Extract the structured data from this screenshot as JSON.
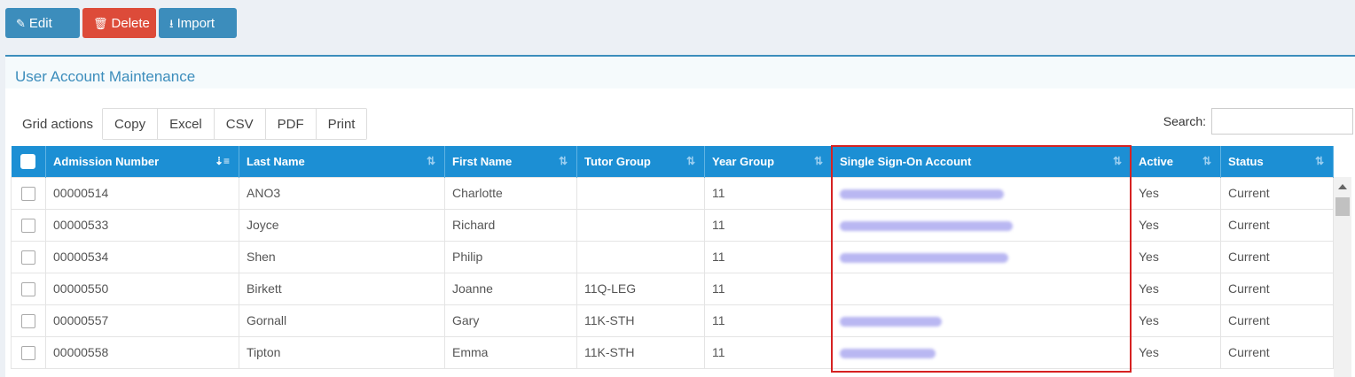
{
  "toolbar": {
    "edit": "Edit",
    "delete": "Delete",
    "import": "Import"
  },
  "panel": {
    "title": "User Account Maintenance"
  },
  "grid_actions": {
    "label": "Grid actions",
    "buttons": [
      "Copy",
      "Excel",
      "CSV",
      "PDF",
      "Print"
    ]
  },
  "search": {
    "label": "Search:",
    "value": ""
  },
  "table": {
    "columns": [
      "",
      "Admission Number",
      "Last Name",
      "First Name",
      "Tutor Group",
      "Year Group",
      "Single Sign-On Account",
      "Active",
      "Status"
    ],
    "rows": [
      {
        "admission": "00000514",
        "last": "ANO3",
        "first": "Charlotte",
        "tutor": "",
        "year": "11",
        "sso_redacted": true,
        "active": "Yes",
        "status": "Current"
      },
      {
        "admission": "00000533",
        "last": "Joyce",
        "first": "Richard",
        "tutor": "",
        "year": "11",
        "sso_redacted": true,
        "active": "Yes",
        "status": "Current"
      },
      {
        "admission": "00000534",
        "last": "Shen",
        "first": "Philip",
        "tutor": "",
        "year": "11",
        "sso_redacted": true,
        "active": "Yes",
        "status": "Current"
      },
      {
        "admission": "00000550",
        "last": "Birkett",
        "first": "Joanne",
        "tutor": "11Q-LEG",
        "year": "11",
        "sso_redacted": false,
        "active": "Yes",
        "status": "Current"
      },
      {
        "admission": "00000557",
        "last": "Gornall",
        "first": "Gary",
        "tutor": "11K-STH",
        "year": "11",
        "sso_redacted": true,
        "active": "Yes",
        "status": "Current"
      },
      {
        "admission": "00000558",
        "last": "Tipton",
        "first": "Emma",
        "tutor": "11K-STH",
        "year": "11",
        "sso_redacted": true,
        "active": "Yes",
        "status": "Current"
      }
    ]
  },
  "colors": {
    "primary": "#3c8dbc",
    "danger": "#dd4b39",
    "table_header": "#1c8fd4",
    "highlight": "#d62222",
    "redaction": "#b9b7f2"
  }
}
